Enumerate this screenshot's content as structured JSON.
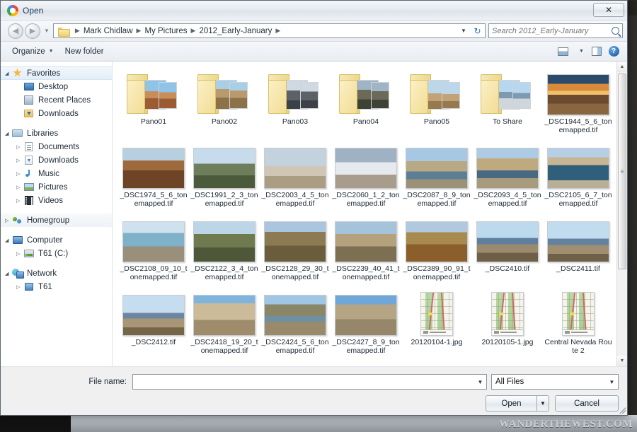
{
  "window": {
    "title": "Open",
    "close_label": "✕",
    "app_icon": "chrome-globe-icon"
  },
  "address_bar": {
    "back_glyph": "◀",
    "forward_glyph": "▶",
    "history_caret": "▼",
    "breadcrumbs": [
      "Mark Chidlaw",
      "My Pictures",
      "2012_Early-January"
    ],
    "separator": "▶",
    "trailing_caret": "▼",
    "refresh_glyph": "↻"
  },
  "search": {
    "placeholder": "Search 2012_Early-January",
    "icon": "magnifier-icon"
  },
  "command_bar": {
    "organize_label": "Organize",
    "organize_caret": "▼",
    "new_folder_label": "New folder",
    "view_caret": "▼",
    "help_label": "?"
  },
  "sidebar": {
    "groups": [
      {
        "header": {
          "label": "Favorites",
          "icon": "star-icon",
          "triangle": "◢",
          "selected": true
        },
        "items": [
          {
            "label": "Desktop",
            "icon": "monitor-icon"
          },
          {
            "label": "Recent Places",
            "icon": "recent-places-icon"
          },
          {
            "label": "Downloads",
            "icon": "downloads-folder-icon"
          }
        ]
      },
      {
        "header": {
          "label": "Libraries",
          "icon": "libraries-icon",
          "triangle": "◢"
        },
        "items": [
          {
            "label": "Documents",
            "icon": "document-icon",
            "triangle": "▷"
          },
          {
            "label": "Downloads",
            "icon": "downloads-library-icon",
            "triangle": "▷"
          },
          {
            "label": "Music",
            "icon": "music-note-icon",
            "triangle": "▷"
          },
          {
            "label": "Pictures",
            "icon": "pictures-icon",
            "triangle": "▷"
          },
          {
            "label": "Videos",
            "icon": "video-film-icon",
            "triangle": "▷"
          }
        ]
      },
      {
        "header": {
          "label": "Homegroup",
          "icon": "homegroup-icon",
          "triangle": "▷",
          "highlighted": true
        },
        "items": []
      },
      {
        "header": {
          "label": "Computer",
          "icon": "computer-icon",
          "triangle": "◢"
        },
        "items": [
          {
            "label": "T61 (C:)",
            "icon": "hard-drive-icon",
            "triangle": "▷"
          }
        ]
      },
      {
        "header": {
          "label": "Network",
          "icon": "network-icon",
          "triangle": "◢"
        },
        "items": [
          {
            "label": "T61",
            "icon": "network-computer-icon",
            "triangle": "▷"
          }
        ]
      }
    ]
  },
  "files": [
    {
      "name": "Pano01",
      "type": "folder",
      "thumb": "canyon-red-rock"
    },
    {
      "name": "Pano02",
      "type": "folder",
      "thumb": "desert-boulders"
    },
    {
      "name": "Pano03",
      "type": "folder",
      "thumb": "mountain-dark"
    },
    {
      "name": "Pano04",
      "type": "folder",
      "thumb": "hills-dusk"
    },
    {
      "name": "Pano05",
      "type": "folder",
      "thumb": "desert-plain"
    },
    {
      "name": "To Share",
      "type": "folder",
      "thumb": "lake-mountain"
    },
    {
      "name": "_DSC1944_5_6_tonemapped.tif",
      "type": "photo",
      "orient": "landscape",
      "thumb": "sunset-desert"
    },
    {
      "name": "_DSC1974_5_6_tonemapped.tif",
      "type": "photo",
      "orient": "landscape",
      "thumb": "campfire-dusk"
    },
    {
      "name": "_DSC1991_2_3_tonemapped.tif",
      "type": "photo",
      "orient": "landscape",
      "thumb": "tree-mountain"
    },
    {
      "name": "_DSC2003_4_5_tonemapped.tif",
      "type": "photo",
      "orient": "landscape",
      "thumb": "camper-playa"
    },
    {
      "name": "_DSC2060_1_2_tonemapped.tif",
      "type": "photo",
      "orient": "landscape",
      "thumb": "salt-flat"
    },
    {
      "name": "_DSC2087_8_9_tonemapped.tif",
      "type": "photo",
      "orient": "landscape",
      "thumb": "hot-spring-pool"
    },
    {
      "name": "_DSC2093_4_5_tonemapped.tif",
      "type": "photo",
      "orient": "landscape",
      "thumb": "hot-spring-desert"
    },
    {
      "name": "_DSC2105_6_7_tonemapped.tif",
      "type": "photo",
      "orient": "landscape",
      "thumb": "soaking-tub"
    },
    {
      "name": "_DSC2108_09_10_tonemapped.tif",
      "type": "photo",
      "orient": "landscape",
      "thumb": "pool-person"
    },
    {
      "name": "_DSC2122_3_4_tonemapped.tif",
      "type": "photo",
      "orient": "landscape",
      "thumb": "trees-valley"
    },
    {
      "name": "_DSC2128_29_30_tonemapped.tif",
      "type": "photo",
      "orient": "landscape",
      "thumb": "rock-tree-slope"
    },
    {
      "name": "_DSC2239_40_41_tonemapped.tif",
      "type": "photo",
      "orient": "landscape",
      "thumb": "truck-camper-desert"
    },
    {
      "name": "_DSC2389_90_91_tonemapped.tif",
      "type": "photo",
      "orient": "landscape",
      "thumb": "truck-autumn-brush"
    },
    {
      "name": "_DSC2410.tif",
      "type": "photo",
      "orient": "landscape",
      "thumb": "blue-mountain-range"
    },
    {
      "name": "_DSC2411.tif",
      "type": "photo",
      "orient": "landscape",
      "thumb": "blue-mountain-range-2"
    },
    {
      "name": "_DSC2412.tif",
      "type": "photo",
      "orient": "landscape",
      "thumb": "valley-distant-range"
    },
    {
      "name": "_DSC2418_19_20_tonemapped.tif",
      "type": "photo",
      "orient": "landscape",
      "thumb": "rocky-hillside"
    },
    {
      "name": "_DSC2424_5_6_tonemapped.tif",
      "type": "photo",
      "orient": "landscape",
      "thumb": "pond-brush"
    },
    {
      "name": "_DSC2427_8_9_tonemapped.tif",
      "type": "photo",
      "orient": "landscape",
      "thumb": "road-hillside"
    },
    {
      "name": "20120104-1.jpg",
      "type": "photo",
      "orient": "portrait",
      "thumb": "topo-map"
    },
    {
      "name": "20120105-1.jpg",
      "type": "photo",
      "orient": "portrait",
      "thumb": "topo-map-2"
    },
    {
      "name": "Central Nevada Route 2",
      "type": "photo",
      "orient": "portrait",
      "thumb": "topo-map-3"
    }
  ],
  "footer": {
    "file_name_label": "File name:",
    "file_name_value": "",
    "file_name_caret": "▼",
    "filter_value": "All Files",
    "filter_caret": "▼",
    "open_label": "Open",
    "open_caret": "▼",
    "cancel_label": "Cancel"
  },
  "scrollbar": {
    "up_glyph": "▲",
    "down_glyph": "▼"
  },
  "watermark": "WANDERTHEWEST.COM"
}
